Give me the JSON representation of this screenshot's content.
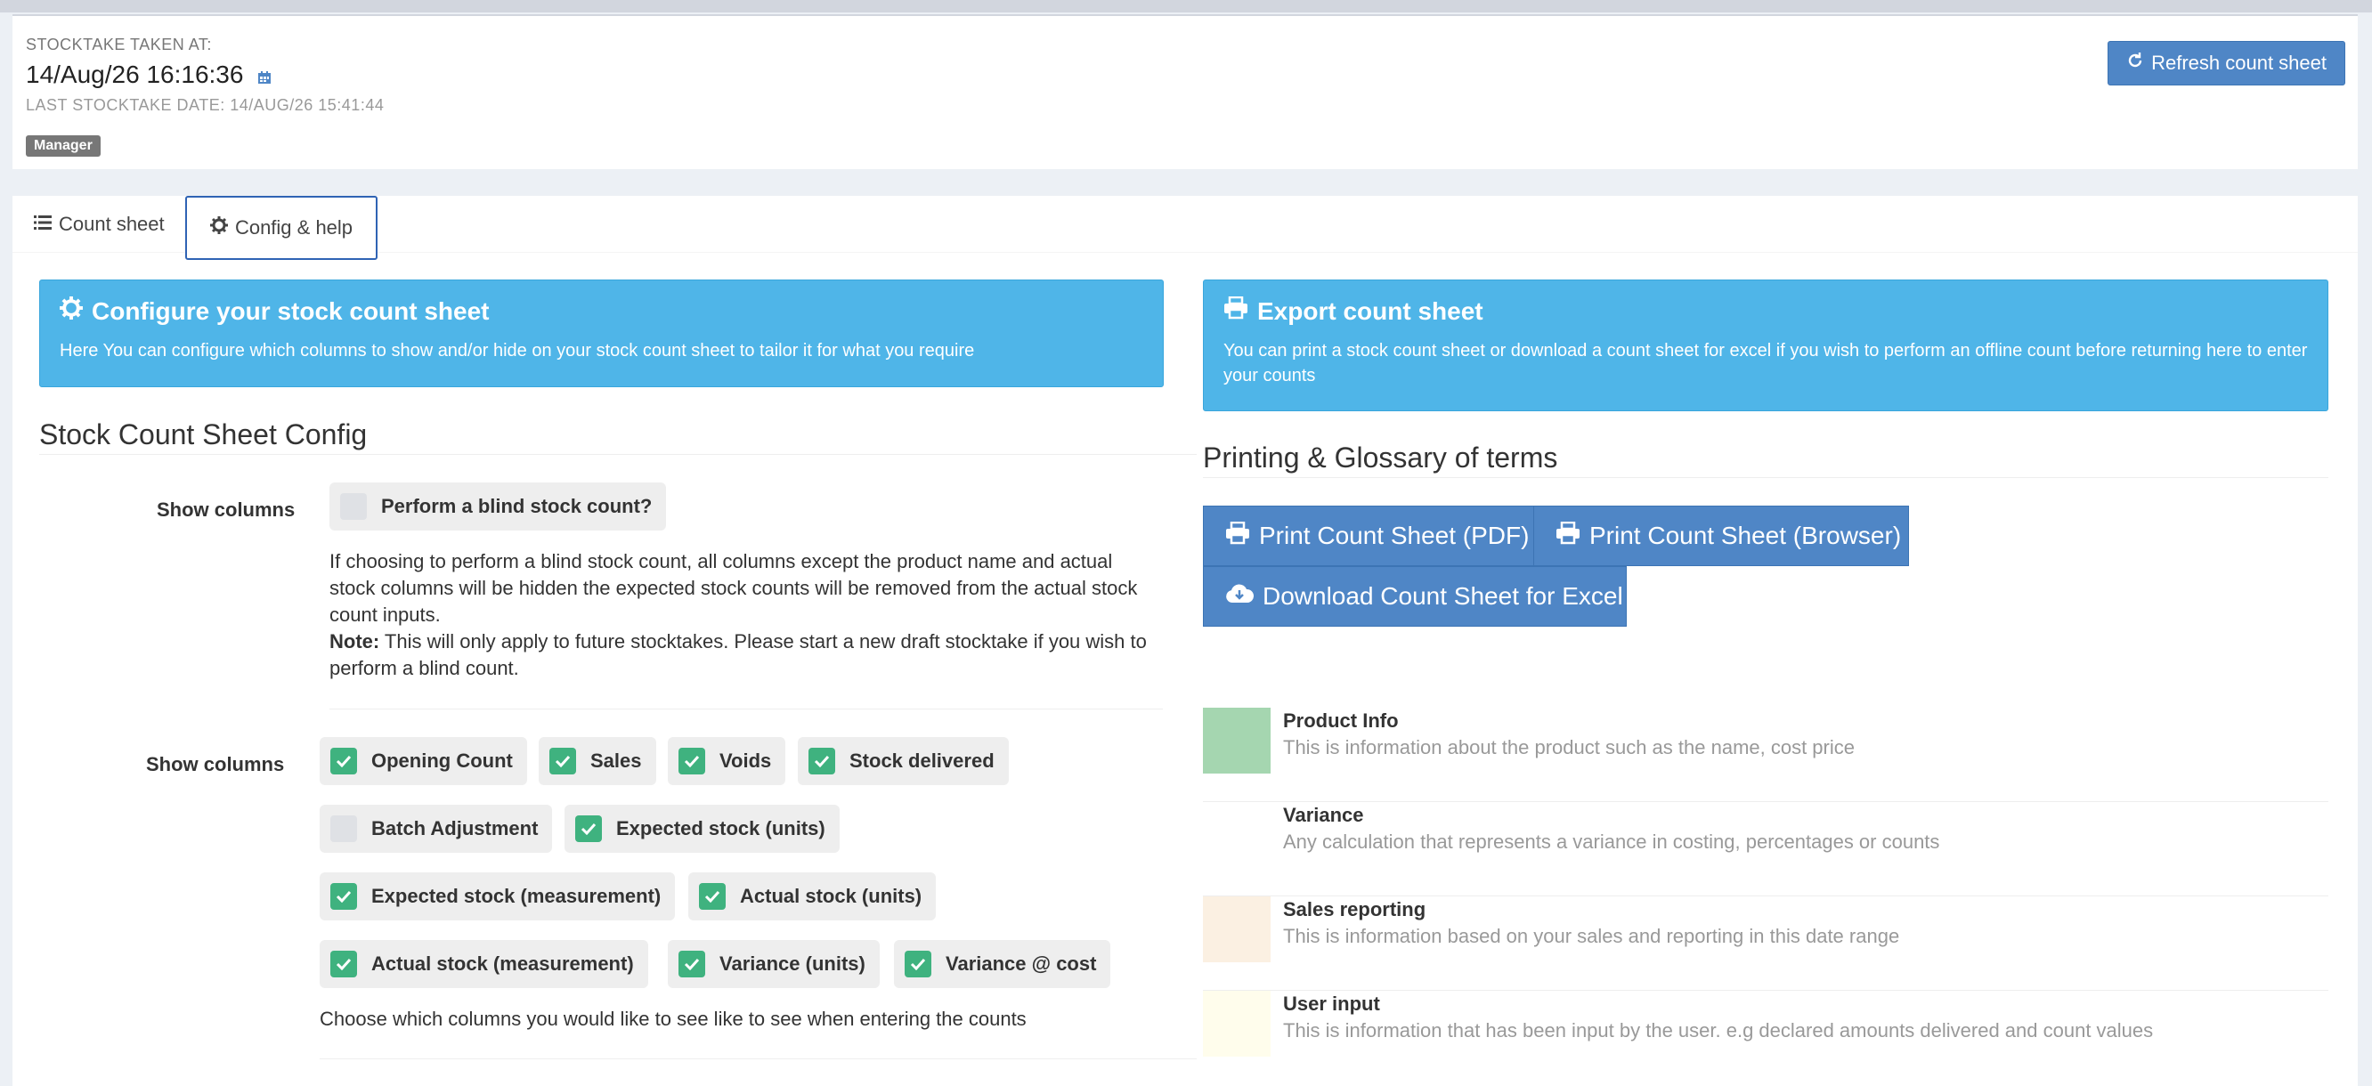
{
  "header": {
    "taken_label": "STOCKTAKE TAKEN AT:",
    "taken_value": "14/Aug/26 16:16:36",
    "last_label": "LAST STOCKTAKE DATE: 14/AUG/26 15:41:44",
    "role_badge": "Manager",
    "refresh_label": "Refresh count sheet"
  },
  "tabs": [
    {
      "label": "Count sheet",
      "icon": "list-icon"
    },
    {
      "label": "Config & help",
      "icon": "gear-icon",
      "active": true
    }
  ],
  "configure_callout": {
    "title": "Configure your stock count sheet",
    "text": "Here You can configure which columns to show and/or hide on your stock count sheet to tailor it for what you require"
  },
  "export_callout": {
    "title": "Export count sheet",
    "text": "You can print a stock count sheet or download a count sheet for excel if you wish to perform an offline count before returning here to enter your counts"
  },
  "config": {
    "section_title": "Stock Count Sheet Config",
    "blind_row_label": "Show columns",
    "blind_label": "Perform a blind stock count?",
    "blind_checked": false,
    "blind_help": "If choosing to perform a blind stock count, all columns except the product name and actual stock columns will be hidden the expected stock counts will be removed from the actual stock count inputs.",
    "note_label": "Note:",
    "note_text": " This will only apply to future stocktakes. Please start a new draft stocktake if you wish to perform a blind count.",
    "columns_row_label": "Show columns",
    "columns": [
      {
        "label": "Opening Count",
        "checked": true
      },
      {
        "label": "Sales",
        "checked": true
      },
      {
        "label": "Voids",
        "checked": true
      },
      {
        "label": "Stock delivered",
        "checked": true
      },
      {
        "label": "Batch Adjustment",
        "checked": false
      },
      {
        "label": "Expected stock (units)",
        "checked": true
      },
      {
        "label": "Expected stock (measurement)",
        "checked": true
      },
      {
        "label": "Actual stock (units)",
        "checked": true
      },
      {
        "label": "Actual stock (measurement)",
        "checked": true
      },
      {
        "label": "Variance (units)",
        "checked": true
      },
      {
        "label": "Variance @ cost",
        "checked": true
      }
    ],
    "columns_help": "Choose which columns you would like to see like to see when entering the counts"
  },
  "printing": {
    "section_title": "Printing & Glossary of terms",
    "print_pdf": "Print Count Sheet (PDF)",
    "print_browser": "Print Count Sheet (Browser)",
    "download_excel": "Download Count Sheet for Excel"
  },
  "glossary": [
    {
      "title": "Product Info",
      "desc": "This is information about the product such as the name, cost price",
      "color": "#a5d6b0"
    },
    {
      "title": "Variance",
      "desc": "Any calculation that represents a variance in costing, percentages or counts",
      "color": "#ffffff"
    },
    {
      "title": "Sales reporting",
      "desc": "This is information based on your sales and reporting in this date range",
      "color": "#fbf0e2"
    },
    {
      "title": "User input",
      "desc": "This is information that has been input by the user. e.g declared amounts delivered and count values",
      "color": "#fffdec"
    }
  ]
}
